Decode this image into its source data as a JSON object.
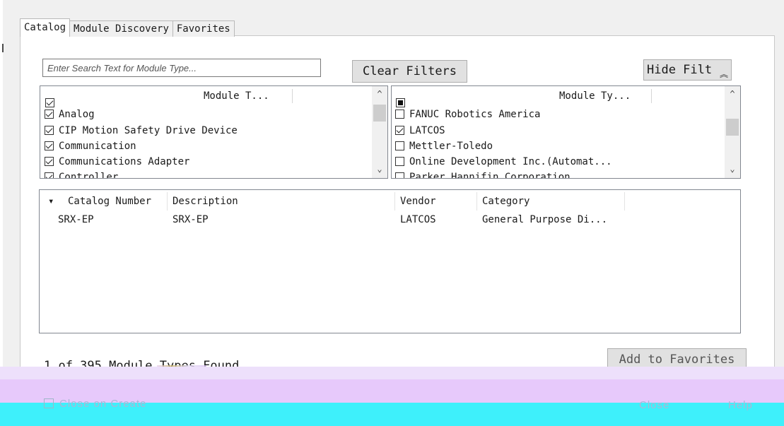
{
  "tabs": [
    {
      "label": "Catalog",
      "active": true
    },
    {
      "label": "Module Discovery",
      "active": false
    },
    {
      "label": "Favorites",
      "active": false
    }
  ],
  "search": {
    "placeholder": "Enter Search Text for Module Type..."
  },
  "buttons": {
    "clear_filters": "Clear Filters",
    "hide_filters": "Hide Filt",
    "add_to_favorites": "Add to Favorites"
  },
  "type_filter": {
    "header": "Module T...",
    "header_state": "checked",
    "items": [
      {
        "label": "Analog",
        "checked": true
      },
      {
        "label": "CIP Motion Safety Drive Device",
        "checked": true
      },
      {
        "label": "Communication",
        "checked": true
      },
      {
        "label": "Communications Adapter",
        "checked": true
      },
      {
        "label": "Controller",
        "checked": true
      }
    ]
  },
  "vendor_filter": {
    "header": "Module Ty...",
    "header_state": "partial",
    "items": [
      {
        "label": "FANUC Robotics America",
        "checked": false
      },
      {
        "label": "LATCOS",
        "checked": true
      },
      {
        "label": "Mettler-Toledo",
        "checked": false
      },
      {
        "label": "Online Development Inc.(Automat...",
        "checked": false
      },
      {
        "label": "Parker Hannifin Corporation",
        "checked": false
      }
    ]
  },
  "results": {
    "columns": [
      "Catalog Number",
      "Description",
      "Vendor",
      "Category"
    ],
    "sort_indicator": "▾",
    "rows": [
      {
        "catalog_number": "SRX-EP",
        "description": "SRX-EP",
        "vendor": "LATCOS",
        "category": "General Purpose Di..."
      }
    ]
  },
  "status": {
    "found_text": "1 of 395 Module Types Found"
  },
  "footer": {
    "close_on_create": "Close on Create",
    "close": "Close",
    "help": "Help"
  },
  "icons": {
    "scroll_up": "chevron-up-icon",
    "scroll_down": "chevron-down-icon",
    "hide_toggle": "double-chevron-up-icon"
  }
}
